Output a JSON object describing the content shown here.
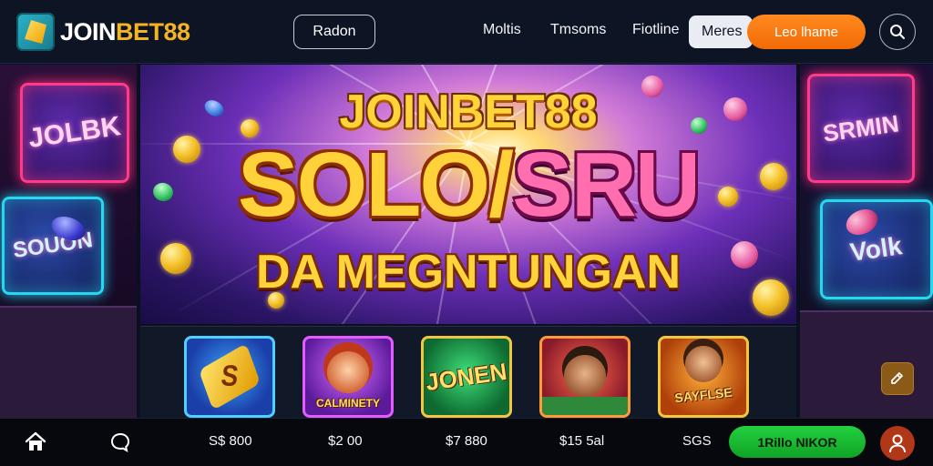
{
  "header": {
    "logo": {
      "part1": "JOIN",
      "part2": "BET88"
    },
    "outline_button": "Radon",
    "nav": [
      "Moltis",
      "Tmsoms",
      "Fiotline"
    ],
    "nav_pill": "Meres",
    "cta_button": "Leo lhame",
    "search_icon": "search-icon"
  },
  "banner": {
    "title_top": "JOINBET88",
    "title_mid_a": "SOLO/",
    "title_mid_b": "SRU",
    "title_bottom": "DA MEGNTUNGAN"
  },
  "side_left": {
    "sign_top": "JOLBK",
    "sign_bottom": "SOUON"
  },
  "side_right": {
    "sign_top": "SRMIN",
    "sign_bottom": "Volk"
  },
  "games": [
    {
      "label": "S",
      "theme": "blue"
    },
    {
      "label": "CALMINETY",
      "theme": "purple"
    },
    {
      "label": "JONEN",
      "theme": "green"
    },
    {
      "label": "",
      "theme": "red"
    },
    {
      "label": "SAYFLSE",
      "theme": "orange"
    }
  ],
  "bottom_bar": {
    "home_icon": "home-icon",
    "chat_icon": "chat-bubble-icon",
    "prices": [
      "S$ 800",
      "$2 00",
      "$7 880",
      "$15 5al",
      "SGS"
    ],
    "green_button": "1Rillo NIKOR",
    "avatar_icon": "user-icon"
  },
  "colors": {
    "accent_orange": "#f26a06",
    "accent_green": "#1cc235",
    "gold": "#f5b324"
  }
}
